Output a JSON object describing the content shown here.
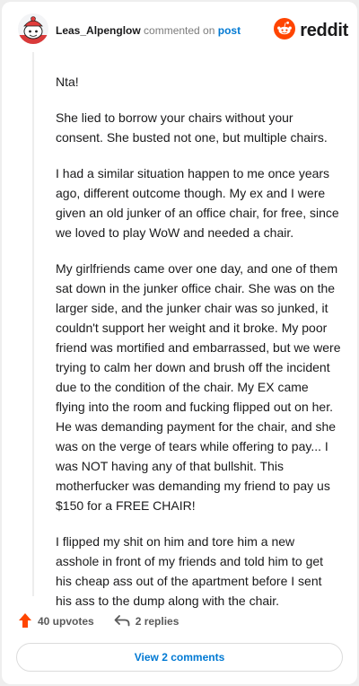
{
  "header": {
    "username": "Leas_Alpenglow",
    "action_text": "commented on",
    "post_link": "post",
    "brand_text": "reddit",
    "avatar_icon": "snoo-avatar-icon",
    "brand_icon": "reddit-logo-icon"
  },
  "comment": {
    "paragraphs": [
      "Nta!",
      "She lied to borrow your chairs without your consent. She busted not one, but multiple chairs.",
      "I had a similar situation happen to me once years ago, different outcome though. My ex and I were given an old junker of an office chair, for free, since we loved to play WoW and needed a chair.",
      "My girlfriends came over one day, and one of them sat down in the junker office chair. She was on the larger side, and the junker chair was so junked, it couldn't support her weight and it broke. My poor friend was mortified and embarrassed, but we were trying to calm her down and brush off the incident due to the condition of the chair. My EX came flying into the room and fucking flipped out on her. He was demanding payment for the chair, and she was on the verge of tears while offering to pay... I was NOT having any of that bullshit. This motherfucker was demanding my friend to pay us $150 for a FREE CHAIR!",
      "I flipped my shit on him and tore him a new asshole in front of my friends and told him to get his cheap ass out of the apartment before I sent his ass to the dump along with the chair."
    ]
  },
  "actions": {
    "upvotes_label": "40 upvotes",
    "replies_label": "2 replies",
    "upvote_icon": "upvote-arrow-icon",
    "reply_icon": "reply-arrow-icon"
  },
  "footer": {
    "view_comments_label": "View 2 comments"
  },
  "colors": {
    "accent": "#0079d3",
    "upvote": "#ff4500",
    "brand": "#ff4500"
  }
}
